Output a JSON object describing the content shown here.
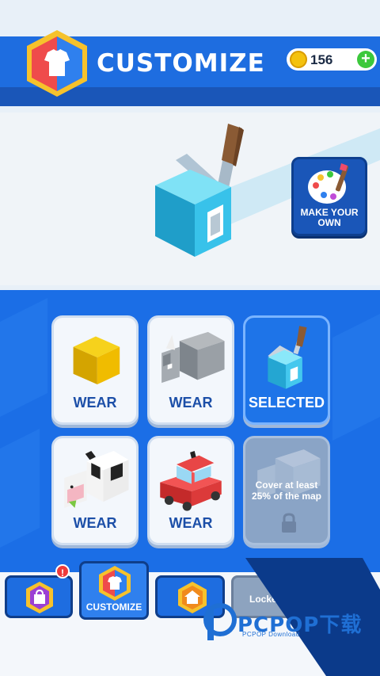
{
  "header": {
    "title": "CUSTOMIZE",
    "coins": "156",
    "logo_icon": "shirt-hex-logo-icon",
    "add_icon": "plus-icon",
    "coin_icon": "coin-icon"
  },
  "preview": {
    "make_own_label": "MAKE YOUR OWN",
    "make_own_icon": "palette-brush-icon"
  },
  "cards": [
    {
      "label": "WEAR",
      "art": "yellow-cube"
    },
    {
      "label": "WEAR",
      "art": "rhino"
    },
    {
      "label": "SELECTED",
      "art": "blue-paint-roller-cube"
    },
    {
      "label": "WEAR",
      "art": "cow"
    },
    {
      "label": "WEAR",
      "art": "red-car"
    },
    {
      "label": "Cover at least 25% of the map",
      "art": "locked-rhino",
      "locked": true
    }
  ],
  "nav": {
    "shop_badge": "!",
    "customize_label": "CUSTOMIZE",
    "home_icon": "house-icon",
    "locked_label": "Locked"
  },
  "watermark": {
    "title": "PCPOP下载",
    "subtitle": "PCPOP Download"
  },
  "colors": {
    "primary_blue": "#1e6de0",
    "grid_blue": "#1b6ee6",
    "selected_blue": "#1e74e8",
    "coin": "#f4c20f",
    "plus": "#3cc83c",
    "badge": "#ef3b3b"
  }
}
